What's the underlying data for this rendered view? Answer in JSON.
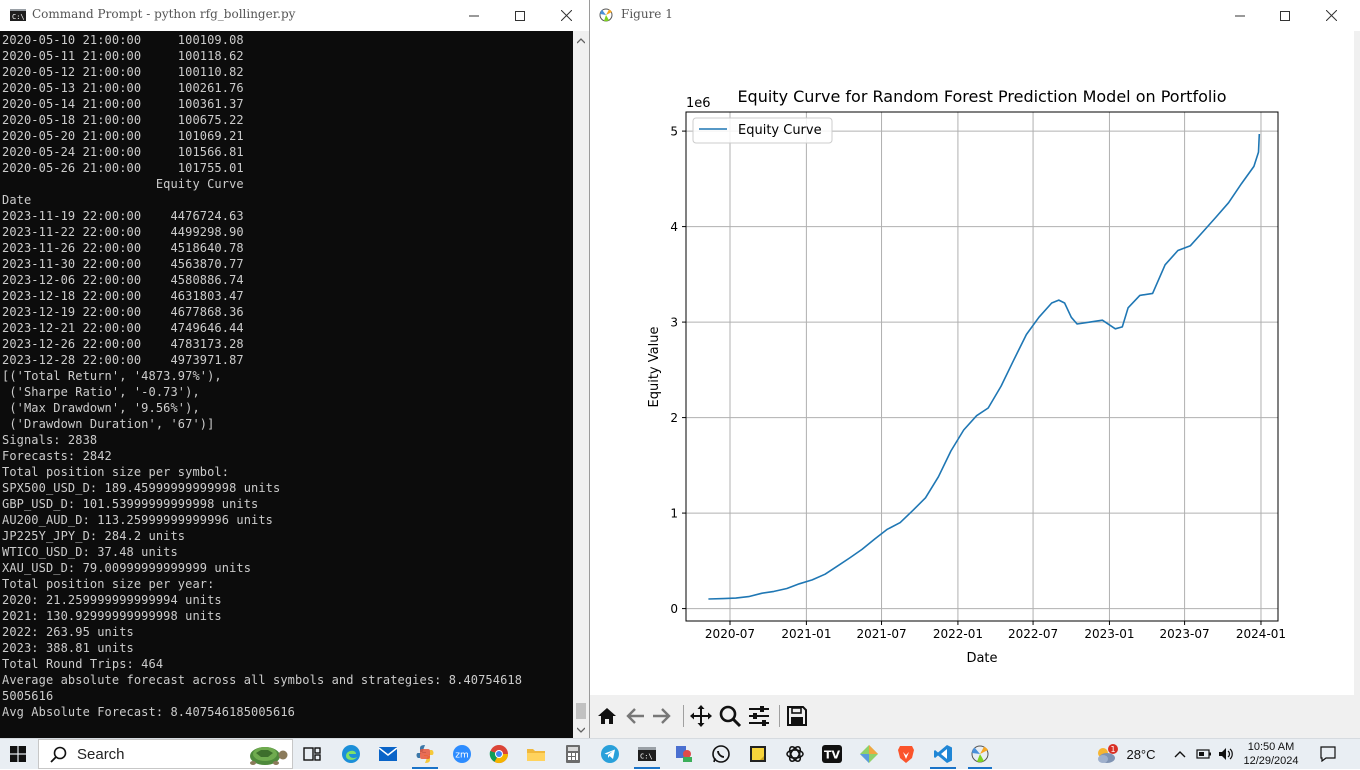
{
  "cmd_window": {
    "title": "Command Prompt - python  rfg_bollinger.py",
    "lines": [
      "2020-05-10 21:00:00     100109.08",
      "2020-05-11 21:00:00     100118.62",
      "2020-05-12 21:00:00     100110.82",
      "2020-05-13 21:00:00     100261.76",
      "2020-05-14 21:00:00     100361.37",
      "2020-05-18 21:00:00     100675.22",
      "2020-05-20 21:00:00     101069.21",
      "2020-05-24 21:00:00     101566.81",
      "2020-05-26 21:00:00     101755.01",
      "                     Equity Curve",
      "Date",
      "2023-11-19 22:00:00    4476724.63",
      "2023-11-22 22:00:00    4499298.90",
      "2023-11-26 22:00:00    4518640.78",
      "2023-11-30 22:00:00    4563870.77",
      "2023-12-06 22:00:00    4580886.74",
      "2023-12-18 22:00:00    4631803.47",
      "2023-12-19 22:00:00    4677868.36",
      "2023-12-21 22:00:00    4749646.44",
      "2023-12-26 22:00:00    4783173.28",
      "2023-12-28 22:00:00    4973971.87",
      "[('Total Return', '4873.97%'),",
      " ('Sharpe Ratio', '-0.73'),",
      " ('Max Drawdown', '9.56%'),",
      " ('Drawdown Duration', '67')]",
      "Signals: 2838",
      "Forecasts: 2842",
      "Total position size per symbol:",
      "SPX500_USD_D: 189.45999999999998 units",
      "GBP_USD_D: 101.53999999999998 units",
      "AU200_AUD_D: 113.25999999999996 units",
      "JP225Y_JPY_D: 284.2 units",
      "WTICO_USD_D: 37.48 units",
      "XAU_USD_D: 79.00999999999999 units",
      "Total position size per year:",
      "2020: 21.259999999999994 units",
      "2021: 130.92999999999998 units",
      "2022: 263.95 units",
      "2023: 388.81 units",
      "Total Round Trips: 464",
      "Average absolute forecast across all symbols and strategies: 8.40754618",
      "5005616",
      "Avg Absolute Forecast: 8.407546185005616"
    ]
  },
  "figure_window": {
    "title": "Figure 1",
    "toolbar": [
      "home-icon",
      "back-arrow-icon",
      "forward-arrow-icon",
      "pan-icon",
      "zoom-icon",
      "configure-subplots-icon",
      "save-icon"
    ]
  },
  "chart_data": {
    "type": "line",
    "title": "Equity Curve for Random Forest Prediction Model on Portfolio",
    "xlabel": "Date",
    "ylabel": "Equity Value",
    "offset_label": "1e6",
    "xlim": [
      "2020-03-17",
      "2024-02-11"
    ],
    "ylim": [
      -0.13,
      5.2
    ],
    "x_ticks": [
      "2020-07",
      "2021-01",
      "2021-07",
      "2022-01",
      "2022-07",
      "2023-01",
      "2023-07",
      "2024-01"
    ],
    "y_ticks": [
      "0",
      "1",
      "2",
      "3",
      "4",
      "5"
    ],
    "grid": true,
    "legend_position": "upper left",
    "series": [
      {
        "name": "Equity Curve",
        "color": "#1f77b4",
        "x": [
          "2020-05-10",
          "2020-06-15",
          "2020-07-15",
          "2020-08-15",
          "2020-09-15",
          "2020-10-15",
          "2020-11-15",
          "2020-12-15",
          "2021-01-15",
          "2021-02-15",
          "2021-03-15",
          "2021-04-15",
          "2021-05-15",
          "2021-06-15",
          "2021-07-15",
          "2021-08-15",
          "2021-09-15",
          "2021-10-15",
          "2021-11-15",
          "2021-12-15",
          "2022-01-15",
          "2022-02-15",
          "2022-03-15",
          "2022-04-15",
          "2022-05-15",
          "2022-06-15",
          "2022-07-15",
          "2022-08-15",
          "2022-09-01",
          "2022-09-15",
          "2022-10-01",
          "2022-10-15",
          "2022-11-15",
          "2022-12-15",
          "2023-01-15",
          "2023-02-01",
          "2023-02-15",
          "2023-03-15",
          "2023-04-15",
          "2023-05-15",
          "2023-06-15",
          "2023-07-15",
          "2023-08-15",
          "2023-09-15",
          "2023-10-15",
          "2023-11-15",
          "2023-12-15",
          "2023-12-26",
          "2023-12-28"
        ],
        "values": [
          0.1,
          0.105,
          0.11,
          0.125,
          0.16,
          0.18,
          0.21,
          0.26,
          0.3,
          0.36,
          0.44,
          0.53,
          0.62,
          0.73,
          0.83,
          0.9,
          1.03,
          1.16,
          1.38,
          1.65,
          1.87,
          2.02,
          2.1,
          2.33,
          2.6,
          2.87,
          3.05,
          3.2,
          3.23,
          3.2,
          3.05,
          2.98,
          3.0,
          3.02,
          2.93,
          2.95,
          3.15,
          3.28,
          3.3,
          3.6,
          3.75,
          3.8,
          3.95,
          4.1,
          4.25,
          4.45,
          4.63,
          4.78,
          4.97
        ]
      }
    ]
  },
  "taskbar": {
    "search_label": "Search",
    "apps": [
      "task-view-icon",
      "edge-icon",
      "mail-icon",
      "python-icon",
      "zoom-app-icon",
      "chrome-icon",
      "file-explorer-icon",
      "calculator-icon",
      "telegram-icon",
      "terminal-icon",
      "people-icon",
      "whatsapp-icon",
      "sticky-notes-icon",
      "openai-icon",
      "tradingview-icon",
      "git-icon",
      "brave-icon",
      "vscode-icon",
      "matplotlib-icon"
    ],
    "weather_badge": "1",
    "temperature": "28°C",
    "time": "10:50 AM",
    "date": "12/29/2024"
  }
}
